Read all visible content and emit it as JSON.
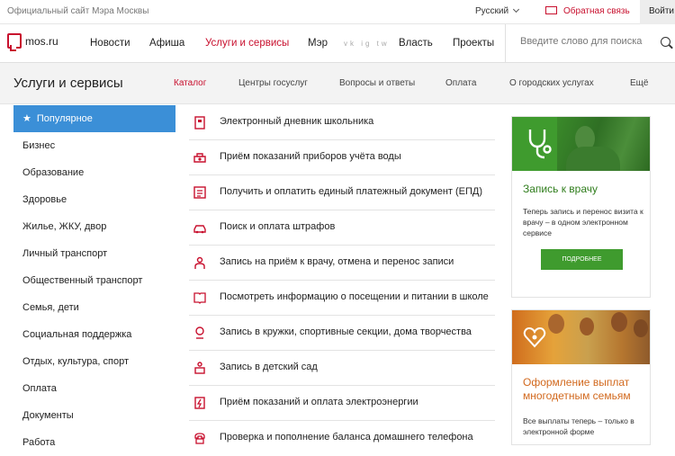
{
  "topbar": {
    "site_label": "Официальный сайт Мэра Москвы",
    "language": "Русский",
    "feedback": "Обратная связь",
    "login": "Войти"
  },
  "nav": {
    "logo_text": "mos.ru",
    "items": [
      "Новости",
      "Афиша",
      "Услуги и сервисы",
      "Мэр",
      "Власть",
      "Проекты"
    ],
    "social": "vk ig tw",
    "search_placeholder": "Введите слово для поиска"
  },
  "subhead": {
    "title": "Услуги и сервисы",
    "tabs": [
      "Каталог",
      "Центры госуслуг",
      "Вопросы и ответы",
      "Оплата",
      "О городских услугах",
      "Ещё"
    ]
  },
  "sidebar": {
    "items": [
      "Популярное",
      "Бизнес",
      "Образование",
      "Здоровье",
      "Жилье, ЖКУ, двор",
      "Личный транспорт",
      "Общественный транспорт",
      "Семья, дети",
      "Социальная поддержка",
      "Отдых, культура, спорт",
      "Оплата",
      "Документы",
      "Работа"
    ]
  },
  "services": [
    "Электронный дневник школьника",
    "Приём показаний приборов учёта воды",
    "Получить и оплатить единый платежный документ (ЕПД)",
    "Поиск и оплата штрафов",
    "Запись на приём к врачу, отмена и перенос записи",
    "Посмотреть информацию о посещении и питании в школе",
    "Запись в кружки, спортивные секции, дома творчества",
    "Запись в детский сад",
    "Приём показаний и оплата электроэнергии",
    "Проверка и пополнение баланса домашнего телефона"
  ],
  "promo1": {
    "title": "Запись к врачу",
    "desc": "Теперь запись и перенос визита к врачу – в одном электронном сервисе",
    "button": "ПОДРОБНЕЕ"
  },
  "promo2": {
    "title": "Оформление выплат многодетным семьям",
    "desc": "Все выплаты теперь – только в электронной форме"
  },
  "colors": {
    "accent": "#c8102e",
    "sidebar_active": "#3b8fd7",
    "green": "#3f9b2e",
    "orange": "#d2691e"
  }
}
